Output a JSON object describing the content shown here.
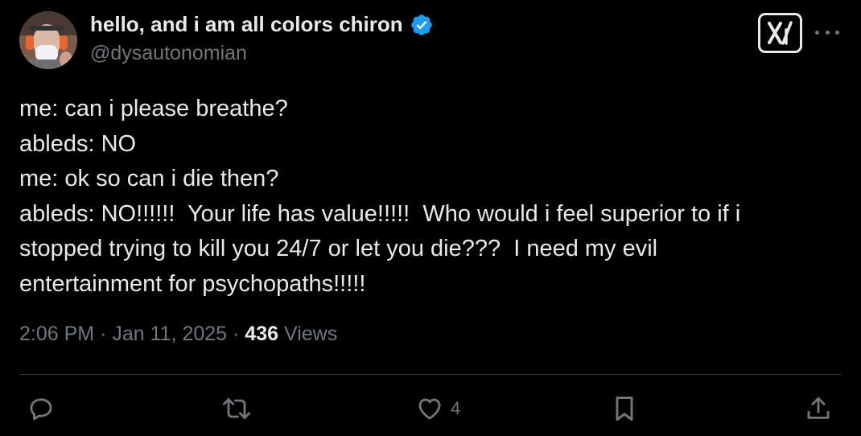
{
  "author": {
    "display_name": "hello, and i am all colors chiron",
    "handle": "@dysautonomian",
    "verified": true,
    "verified_color": "#1d9bf0"
  },
  "tweet": {
    "lines": [
      "me: can i please breathe?",
      "ableds: NO",
      "me: ok so can i die then?",
      "ableds: NO!!!!!!  Your life has value!!!!!  Who would i feel superior to if i",
      "stopped trying to kill you 24/7 or let you die???  I need my evil",
      "entertainment for psychopaths!!!!!"
    ]
  },
  "meta": {
    "time": "2:06 PM",
    "separator": "·",
    "date": "Jan 11, 2025",
    "views_count": "436",
    "views_label": "Views"
  },
  "actions": {
    "like_count": "4"
  },
  "icons": {
    "logo": "x-logo-icon",
    "more": "more-icon",
    "reply": "reply-icon",
    "retweet": "retweet-icon",
    "like": "heart-icon",
    "bookmark": "bookmark-icon",
    "share": "share-icon"
  },
  "colors": {
    "background": "#000000",
    "text": "#e7e9ea",
    "secondary": "#71767b",
    "divider": "#2f3336"
  }
}
